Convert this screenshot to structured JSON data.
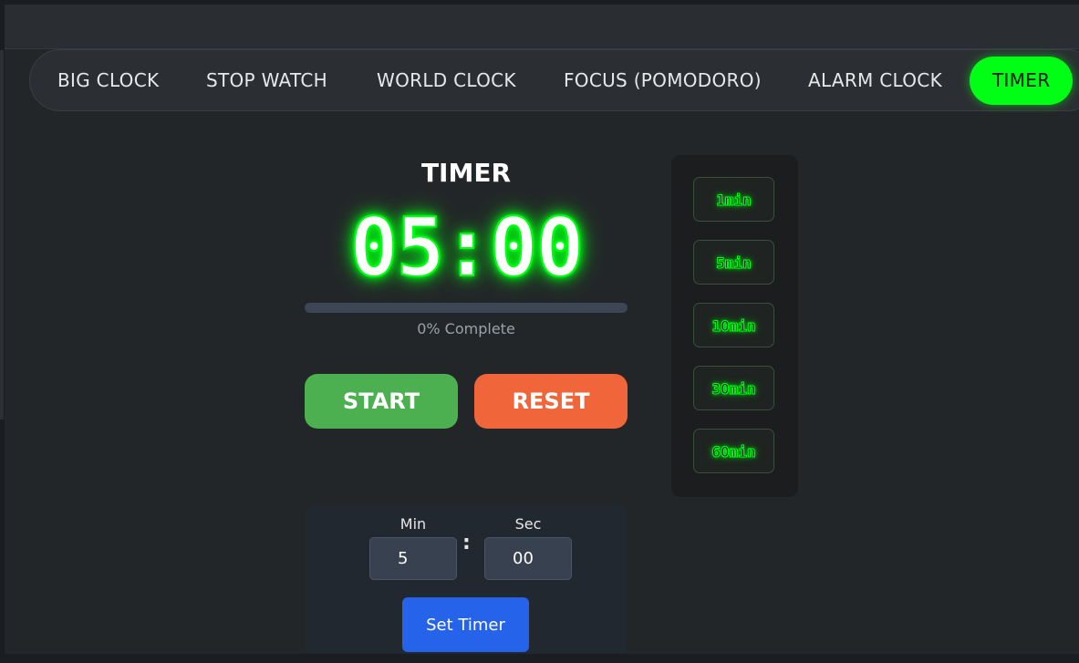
{
  "nav": {
    "items": [
      {
        "label": "BIG CLOCK"
      },
      {
        "label": "STOP WATCH"
      },
      {
        "label": "WORLD CLOCK"
      },
      {
        "label": "FOCUS (POMODORO)"
      },
      {
        "label": "ALARM CLOCK"
      },
      {
        "label": "TIMER",
        "active": true
      }
    ]
  },
  "timer": {
    "title": "TIMER",
    "display": "05:00",
    "progress_percent": 0,
    "progress_text": "0% Complete",
    "start_label": "START",
    "reset_label": "RESET"
  },
  "presets": {
    "items": [
      "1min",
      "5min",
      "10min",
      "30min",
      "60min"
    ]
  },
  "custom": {
    "min_label": "Min",
    "sec_label": "Sec",
    "min_value": "5",
    "sec_value": "00",
    "separator": ":",
    "set_label": "Set Timer"
  },
  "colors": {
    "accent_green": "#00ff14",
    "start": "#4caf50",
    "reset": "#f0663a",
    "set": "#2563eb",
    "background": "#232629"
  }
}
